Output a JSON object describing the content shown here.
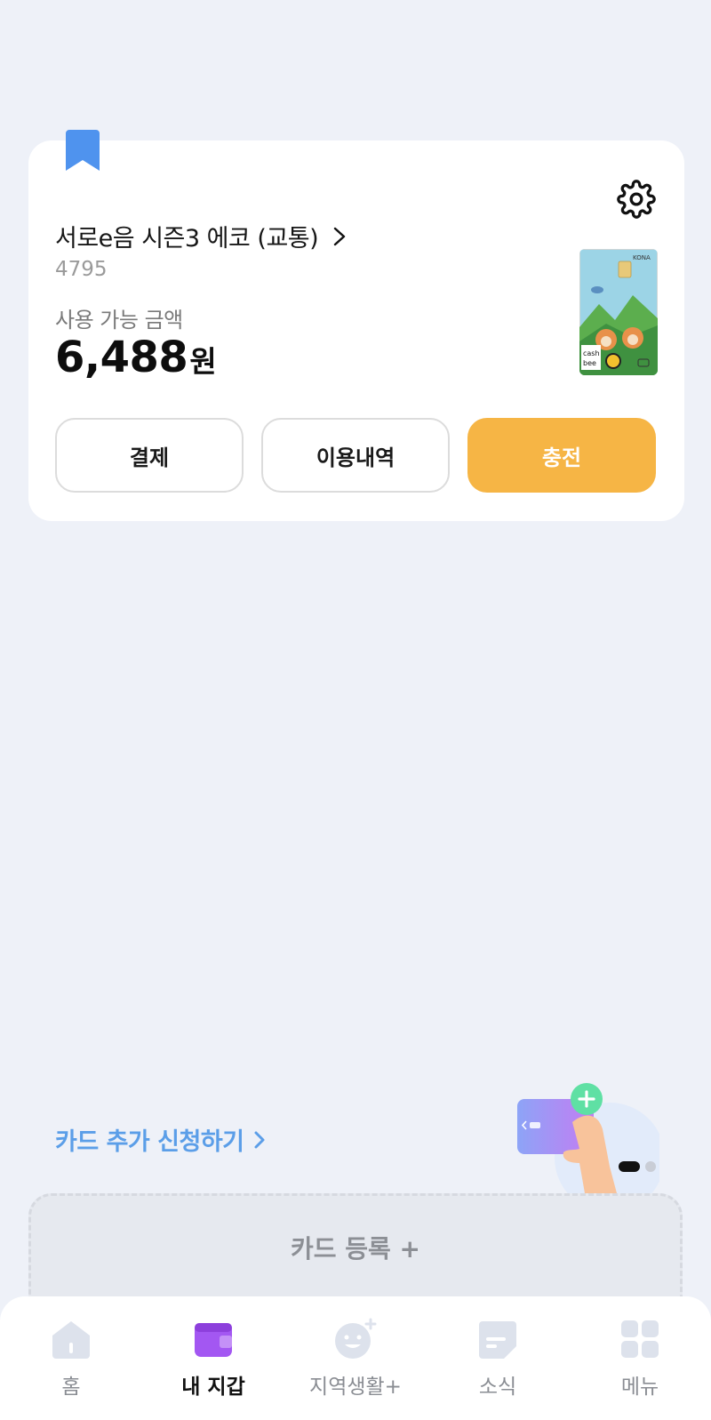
{
  "card": {
    "title": "서로e음 시즌3 에코 (교통)",
    "number": "4795",
    "balance_label": "사용 가능 금액",
    "balance_value": "6,488",
    "balance_unit": "원",
    "buttons": {
      "pay": "결제",
      "history": "이용내역",
      "charge": "충전"
    },
    "image_text": {
      "brand": "KONA",
      "cash": "cash",
      "bee": "bee"
    }
  },
  "promo": {
    "label": "카드 추가 신청하기"
  },
  "pagination": {
    "current": 1,
    "total": 2
  },
  "register": {
    "label": "카드 등록 +"
  },
  "nav": {
    "items": [
      {
        "label": "홈",
        "icon": "home-icon"
      },
      {
        "label": "내 지갑",
        "icon": "wallet-icon"
      },
      {
        "label": "지역생활+",
        "icon": "local-life-icon"
      },
      {
        "label": "소식",
        "icon": "news-icon"
      },
      {
        "label": "메뉴",
        "icon": "menu-grid-icon"
      }
    ],
    "active_index": 1
  },
  "colors": {
    "background": "#eef1f8",
    "accent_orange": "#f6b545",
    "accent_blue": "#5b9ee8",
    "bookmark_blue": "#4f93ee",
    "active_purple": "#a357f2",
    "inactive_icon": "#dde2ec"
  }
}
